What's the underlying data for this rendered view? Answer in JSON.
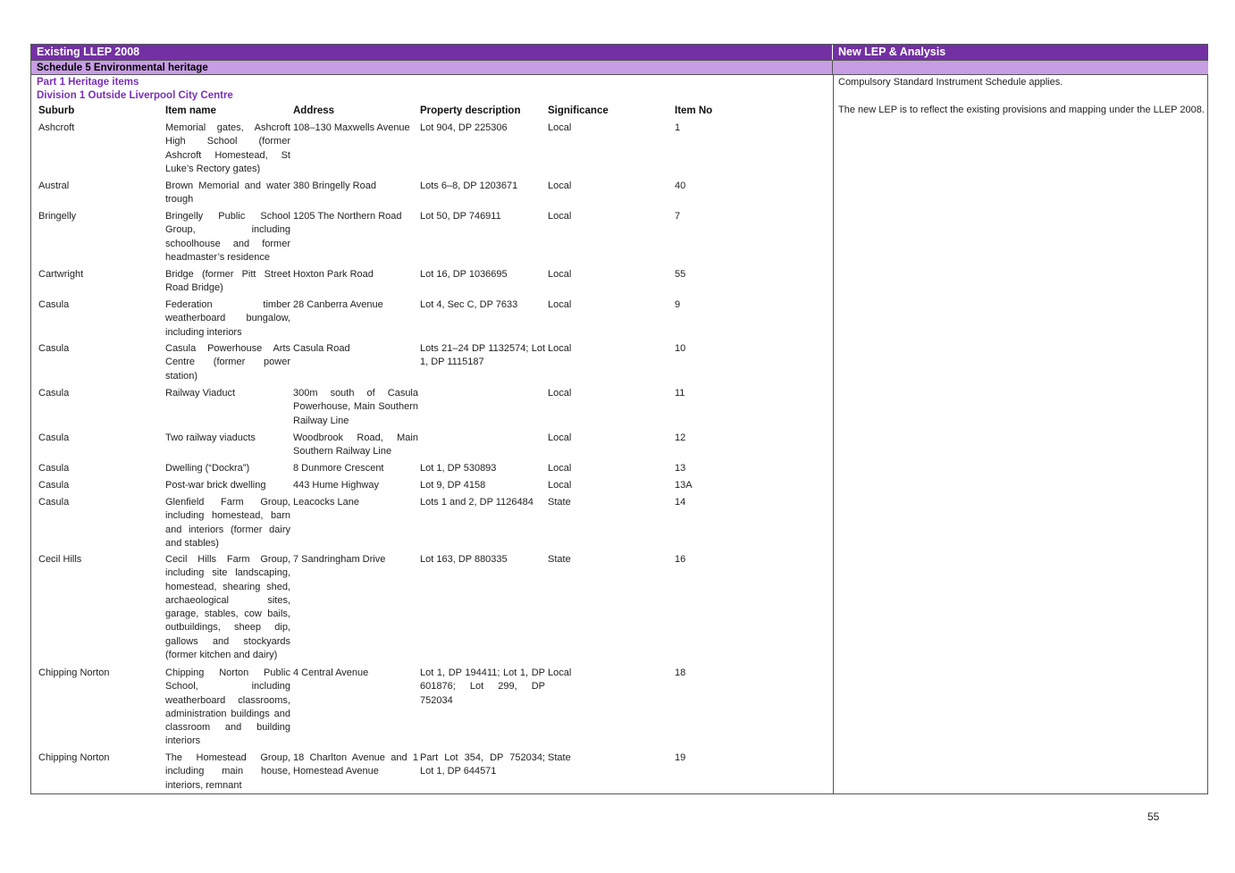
{
  "header": {
    "left_title": "Existing LLEP 2008",
    "right_title": "New LEP & Analysis",
    "schedule_title": "Schedule 5 Environmental heritage",
    "part_title": "Part 1 Heritage items",
    "division_title": "Division 1 Outside Liverpool City Centre"
  },
  "analysis": {
    "para1": "Compulsory Standard Instrument Schedule applies.",
    "para2": "The new LEP is to reflect the existing provisions and mapping under the LLEP 2008."
  },
  "columns": {
    "suburb": "Suburb",
    "item_name": "Item name",
    "address": "Address",
    "property": "Property description",
    "significance": "Significance",
    "item_no": "Item No"
  },
  "rows": [
    {
      "suburb": "Ashcroft",
      "item_name": "Memorial gates, Ashcroft High School (former Ashcroft Homestead, St Luke’s Rectory gates)",
      "address": "108–130 Maxwells Avenue",
      "property": "Lot 904, DP 225306",
      "significance": "Local",
      "item_no": "1"
    },
    {
      "suburb": "Austral",
      "item_name": "Brown Memorial and water trough",
      "address": "380 Bringelly Road",
      "property": "Lots 6–8, DP 1203671",
      "significance": "Local",
      "item_no": "40"
    },
    {
      "suburb": "Bringelly",
      "item_name": "Bringelly Public School Group, including schoolhouse and former headmaster’s residence",
      "address": "1205 The Northern Road",
      "property": "Lot 50, DP 746911",
      "significance": "Local",
      "item_no": "7"
    },
    {
      "suburb": "Cartwright",
      "item_name": "Bridge (former Pitt Street Road Bridge)",
      "address": "Hoxton Park Road",
      "property": "Lot 16, DP 1036695",
      "significance": "Local",
      "item_no": "55"
    },
    {
      "suburb": "Casula",
      "item_name": "Federation timber weatherboard bungalow, including interiors",
      "address": "28 Canberra Avenue",
      "property": "Lot 4, Sec C, DP 7633",
      "significance": "Local",
      "item_no": "9"
    },
    {
      "suburb": "Casula",
      "item_name": "Casula Powerhouse Arts Centre (former power station)",
      "address": "Casula Road",
      "property": "Lots 21–24 DP 1132574; Lot 1, DP 1115187",
      "significance": "Local",
      "item_no": "10"
    },
    {
      "suburb": "Casula",
      "item_name": "Railway Viaduct",
      "address": "300m south of Casula Powerhouse, Main Southern Railway Line",
      "property": "",
      "significance": "Local",
      "item_no": "11"
    },
    {
      "suburb": "Casula",
      "item_name": "Two railway viaducts",
      "address": "Woodbrook Road, Main Southern Railway Line",
      "property": "",
      "significance": "Local",
      "item_no": "12"
    },
    {
      "suburb": "Casula",
      "item_name": "Dwelling (“Dockra”)",
      "address": "8 Dunmore Crescent",
      "property": "Lot 1, DP 530893",
      "significance": "Local",
      "item_no": "13"
    },
    {
      "suburb": "Casula",
      "item_name": "Post-war brick dwelling",
      "address": "443 Hume Highway",
      "property": "Lot 9, DP 4158",
      "significance": "Local",
      "item_no": "13A"
    },
    {
      "suburb": "Casula",
      "item_name": "Glenfield Farm Group, including homestead, barn and interiors (former dairy and stables)",
      "address": "Leacocks Lane",
      "property": "Lots 1 and 2, DP 1126484",
      "significance": "State",
      "item_no": "14"
    },
    {
      "suburb": "Cecil Hills",
      "item_name": "Cecil Hills Farm Group, including site landscaping, homestead, shearing shed, archaeological sites, garage, stables, cow bails, outbuildings, sheep dip, gallows and stockyards (former kitchen and dairy)",
      "address": "7 Sandringham Drive",
      "property": "Lot 163, DP 880335",
      "significance": "State",
      "item_no": "16"
    },
    {
      "suburb": "Chipping Norton",
      "item_name": "Chipping Norton Public School, including weatherboard classrooms, administration buildings and classroom and building interiors",
      "address": "4 Central Avenue",
      "property": "Lot 1, DP 194411; Lot 1, DP 601876; Lot 299, DP 752034",
      "significance": "Local",
      "item_no": "18"
    },
    {
      "suburb": "Chipping Norton",
      "item_name": "The Homestead Group, including main house, interiors, remnant",
      "address": "18 Charlton Avenue and 1 Homestead Avenue",
      "property": "Part Lot 354, DP 752034; Lot 1, DP 644571",
      "significance": "State",
      "item_no": "19"
    }
  ],
  "page_number": "55"
}
